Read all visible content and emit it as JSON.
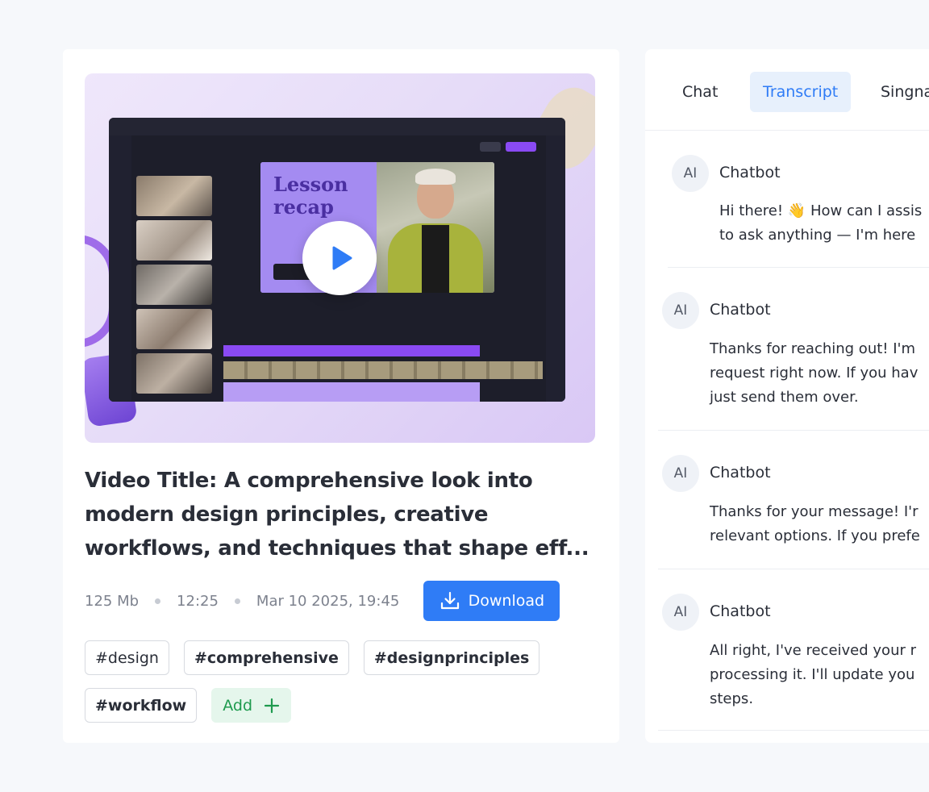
{
  "video": {
    "title": "Video Title: A comprehensive look into modern design principles, creative workflows, and techniques that shape eff...",
    "thumbnail_text_line1": "Lesson",
    "thumbnail_text_line2": "recap",
    "size": "125 Mb",
    "duration": "12:25",
    "date": "Mar 10 2025, 19:45",
    "download_label": "Download"
  },
  "tags": [
    "#design",
    "#comprehensive",
    "#designprinciples",
    "#workflow"
  ],
  "add_tag_label": "Add",
  "tabs": [
    {
      "label": "Chat",
      "active": false
    },
    {
      "label": "Transcript",
      "active": true
    },
    {
      "label": "Singna",
      "active": false
    }
  ],
  "messages": [
    {
      "avatar": "AI",
      "sender": "Chatbot",
      "lines": [
        "Hi there! 👋 How can I assis",
        "to ask anything — I'm here"
      ]
    },
    {
      "avatar": "AI",
      "sender": "Chatbot",
      "lines": [
        "Thanks for reaching out! I'm",
        "request right now. If you hav",
        "just send them over."
      ]
    },
    {
      "avatar": "AI",
      "sender": "Chatbot",
      "lines": [
        "Thanks for your message! I'r",
        "relevant options. If you prefe"
      ]
    },
    {
      "avatar": "AI",
      "sender": "Chatbot",
      "lines": [
        "All right, I've received your r",
        "processing it. I'll update you",
        "steps."
      ]
    }
  ],
  "colors": {
    "accent_blue": "#2f7cf6",
    "add_green": "#1e9a4e",
    "editor_purple": "#8a4af3"
  }
}
